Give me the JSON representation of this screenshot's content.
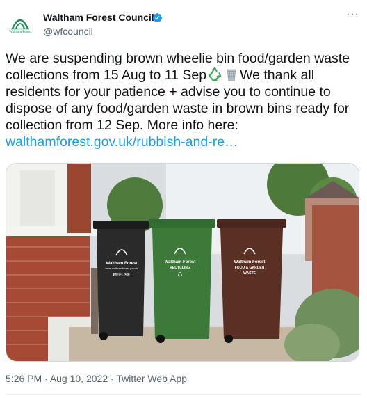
{
  "account": {
    "name": "Waltham Forest Council",
    "handle": "@wfcouncil",
    "avatar_text": "Waltham Forest"
  },
  "menu": {
    "more_label": "···"
  },
  "tweet": {
    "text_part1": "We are suspending brown wheelie bin food/garden waste collections from 15 Aug to 11 Sep",
    "text_part2": "We thank all residents for your patience + advise you to continue to dispose of any food/garden waste in brown bins ready for collection from 12 Sep. More info here: ",
    "link": "walthamforest.gov.uk/rubbish-and-re…",
    "emojis": [
      "recycling-symbol",
      "wastebasket"
    ]
  },
  "media": {
    "bins": [
      {
        "label_line1": "Waltham Forest",
        "label_line2": "www.walthamforest.gov.uk",
        "label_line3": "REFUSE",
        "color": "#2a2a2a"
      },
      {
        "label_line1": "Waltham Forest",
        "label_line2": "RECYCLING",
        "label_line3": "♺",
        "color": "#3d7a3a"
      },
      {
        "label_line1": "Waltham Forest",
        "label_line2": "FOOD & GARDEN",
        "label_line3": "WASTE",
        "color": "#5a3024"
      }
    ]
  },
  "meta": {
    "time": "5:26 PM",
    "sep1": " · ",
    "date": "Aug 10, 2022",
    "sep2": " · ",
    "source": "Twitter Web App"
  },
  "colors": {
    "link": "#1d9bf0",
    "verified": "#1d9bf0",
    "secondary": "#536471"
  }
}
